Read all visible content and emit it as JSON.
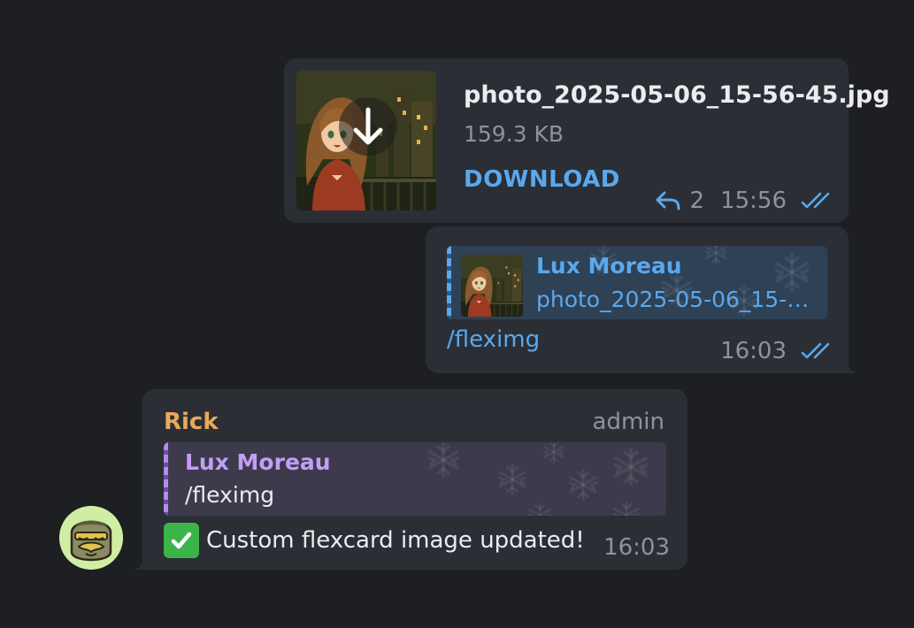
{
  "file_message": {
    "file_name": "photo_2025-05-06_15-56-45.jpg",
    "file_size": "159.3 KB",
    "download_label": "DOWNLOAD",
    "reply_count": "2",
    "time": "15:56",
    "icons": {
      "download": "arrow-down-icon",
      "reply": "reply-arrow-icon",
      "status": "double-check-icon"
    }
  },
  "command_message": {
    "quote_author": "Lux Moreau",
    "quote_text": "photo_2025-05-06_15-56-45.jpg",
    "command": "/fleximg",
    "time": "16:03"
  },
  "bot_message": {
    "sender": "Rick",
    "role": "admin",
    "quote_author": "Lux Moreau",
    "quote_text": "/fleximg",
    "text": "Custom flexcard image updated!",
    "emoji": "check-mark-button-icon",
    "time": "16:03"
  },
  "colors": {
    "background": "#1d1f23",
    "bubble": "#2b2f35",
    "accent": "#5aa8ee",
    "sender_name": "#e9a85b",
    "quote_accent": "#c39ef5",
    "muted": "#8b939c"
  }
}
